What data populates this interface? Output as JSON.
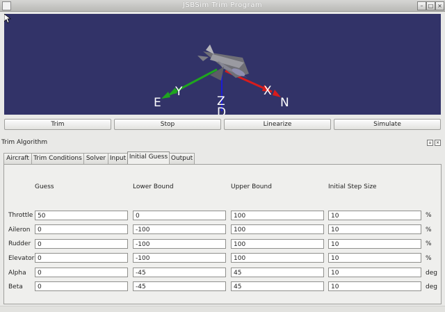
{
  "window": {
    "title": "JSBSim Trim Program"
  },
  "viewport": {
    "background": "#323368",
    "axis_labels": {
      "e": "E",
      "y": "Y",
      "z": "Z",
      "x": "X",
      "n": "N",
      "d": "D"
    },
    "axis_colors": {
      "y_axis": "#1fa51f",
      "x_axis": "#d81c1c",
      "z_axis": "#1c1cd8"
    }
  },
  "toolbar": {
    "buttons": [
      "Trim",
      "Stop",
      "Linearize",
      "Simulate"
    ]
  },
  "dock": {
    "title": "Trim Algorithm"
  },
  "tabs": [
    "Aircraft",
    "Trim Conditions",
    "Solver",
    "Input",
    "Initial Guess",
    "Output"
  ],
  "active_tab": "Initial Guess",
  "table": {
    "columns": [
      "Guess",
      "Lower Bound",
      "Upper Bound",
      "Initial Step Size"
    ],
    "rows": [
      {
        "label": "Throttle",
        "guess": "50",
        "lower": "0",
        "upper": "100",
        "step": "10",
        "unit": "%"
      },
      {
        "label": "Aileron",
        "guess": "0",
        "lower": "-100",
        "upper": "100",
        "step": "10",
        "unit": "%"
      },
      {
        "label": "Rudder",
        "guess": "0",
        "lower": "-100",
        "upper": "100",
        "step": "10",
        "unit": "%"
      },
      {
        "label": "Elevator",
        "guess": "0",
        "lower": "-100",
        "upper": "100",
        "step": "10",
        "unit": "%"
      },
      {
        "label": "Alpha",
        "guess": "0",
        "lower": "-45",
        "upper": "45",
        "step": "10",
        "unit": "deg"
      },
      {
        "label": "Beta",
        "guess": "0",
        "lower": "-45",
        "upper": "45",
        "step": "10",
        "unit": "deg"
      }
    ]
  }
}
